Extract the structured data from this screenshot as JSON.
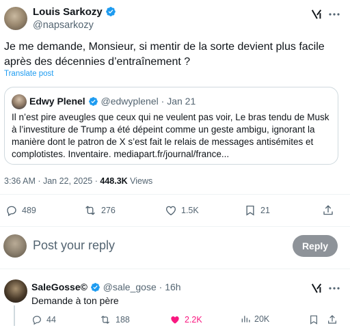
{
  "main_post": {
    "author_name": "Louis Sarkozy",
    "author_handle": "@napsarkozy",
    "text": "Je me demande, Monsieur, si mentir de la sorte devient plus facile après des décennies d’entraînement ?",
    "translate_label": "Translate post",
    "timestamp": "3:36 AM · Jan 22, 2025",
    "separator": " · ",
    "views_count": "448.3K",
    "views_label": " Views",
    "stats": {
      "replies": "489",
      "reposts": "276",
      "likes": "1.5K",
      "bookmarks": "21"
    }
  },
  "quoted_post": {
    "author_name": "Edwy Plenel",
    "author_handle": "@edwyplenel",
    "date": "· Jan 21",
    "text": "Il n’est pire aveugles que ceux qui ne veulent pas voir, Le bras tendu de Musk à l’investiture de Trump a été dépeint comme un geste ambigu, ignorant la manière dont le patron de X s’est fait le relais de messages antisémites et complotistes. Inventaire.  mediapart.fr/journal/france..."
  },
  "reply_composer": {
    "placeholder": "Post your reply",
    "button_label": "Reply"
  },
  "reply_post": {
    "author_name": "SaleGosse©",
    "author_handle": "@sale_gose",
    "date": "· 16h",
    "text": "Demande à ton père",
    "stats": {
      "replies": "44",
      "reposts": "188",
      "likes": "2.2K",
      "views": "20K"
    }
  },
  "colors": {
    "accent": "#1d9bf0",
    "like": "#f91880",
    "reply_button_bg": "#8e9399"
  },
  "icons": [
    "verified-badge-icon",
    "grok-icon",
    "more-icon",
    "reply-icon",
    "repost-icon",
    "like-icon",
    "bookmark-icon",
    "share-icon",
    "views-icon"
  ]
}
